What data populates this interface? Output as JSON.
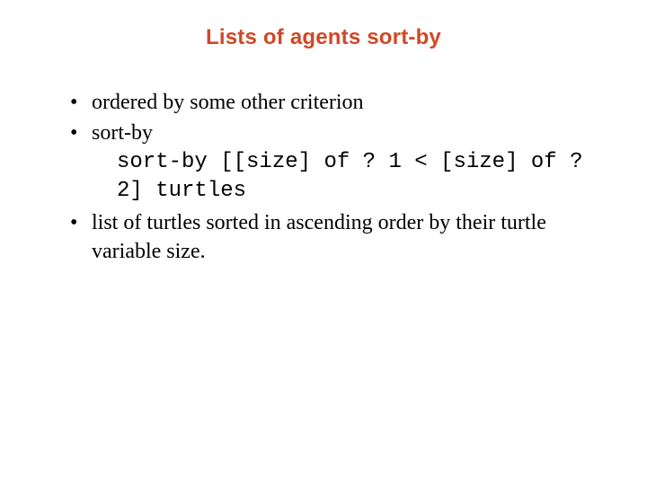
{
  "title": "Lists of agents sort-by",
  "bullets": {
    "item1": "ordered by some other criterion",
    "item2": "sort-by",
    "item2_code": "sort-by [[size] of ? 1 < [size] of ? 2] turtles",
    "item3": "list of turtles sorted in ascending order by their turtle variable size."
  }
}
